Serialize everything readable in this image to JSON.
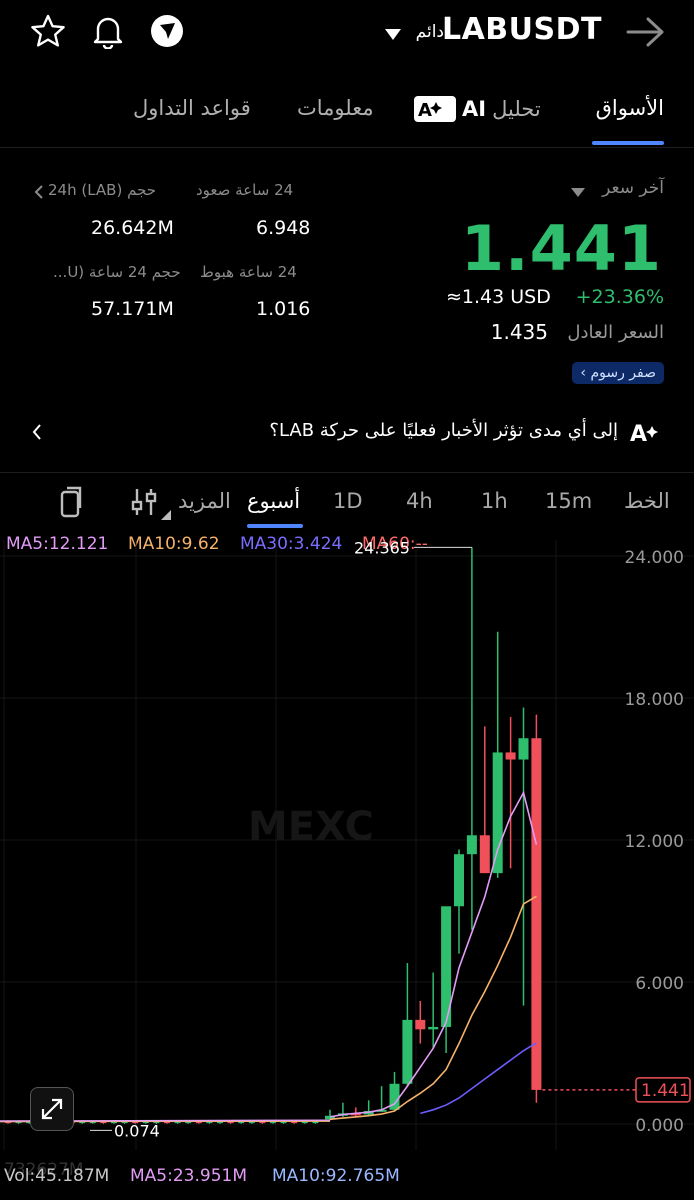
{
  "header": {
    "symbol": "LABUSDT",
    "contract_type": "دائم",
    "icons": [
      "star-icon",
      "bell-icon",
      "share-icon",
      "back-arrow-icon",
      "caret-down-icon"
    ]
  },
  "tabs": [
    {
      "label": "الأسواق",
      "active": true
    },
    {
      "label": "تحليل",
      "ai": "AI",
      "active": false
    },
    {
      "label": "معلومات",
      "active": false
    },
    {
      "label": "قواعد التداول",
      "active": false
    }
  ],
  "price": {
    "last_label": "آخر سعر",
    "last": "1.441",
    "usd": "≈1.43 USD",
    "change": "+23.36%",
    "fair_label": "السعر العادل",
    "fair": "1.435",
    "fee_badge": "صفر رسوم"
  },
  "stats": {
    "high_label": "24 ساعة صعود",
    "high": "6.948",
    "low_label": "24 ساعة هبوط",
    "low": "1.016",
    "vol_lab_label": "حجم 24h (LAB)",
    "vol_lab": "26.642M",
    "vol_u_label": "حجم 24 ساعة (U...",
    "vol_u": "57.171M"
  },
  "news": {
    "text": "إلى أي مدى تؤثر الأخبار فعليًا على حركة LAB؟"
  },
  "intervals": {
    "line": "الخط",
    "m15": "15m",
    "h1": "1h",
    "h4": "4h",
    "d1": "1D",
    "week": "أسبوع",
    "more": "المزيد"
  },
  "chart_data": {
    "type": "candlestick",
    "interval": "أسبوع",
    "ma_labels": {
      "ma5": "MA5:12.121",
      "ma10": "MA10:9.62",
      "ma30": "MA30:3.424",
      "ma60": "MA60:--"
    },
    "y_ticks": [
      "24.000",
      "18.000",
      "12.000",
      "6.000",
      "0.000"
    ],
    "y_tick_values": [
      24,
      18,
      12,
      6,
      0
    ],
    "ylim": [
      -0.3,
      24.9
    ],
    "high_marker": "24.365",
    "low_marker": "0.074",
    "current_price": "1.441",
    "current": 1.441,
    "watermark": "MEXC",
    "colors": {
      "up": "#2fbd6e",
      "down": "#f0505a",
      "ma5": "#e39cf6",
      "ma10": "#f6b36a",
      "ma30": "#6d5cff",
      "ma60": "#ff6b6b"
    },
    "flat_count": 30,
    "flat_value": 0.08,
    "candles": [
      {
        "o": 0.2,
        "h": 0.6,
        "l": 0.15,
        "c": 0.35
      },
      {
        "o": 0.35,
        "h": 0.9,
        "l": 0.3,
        "c": 0.45
      },
      {
        "o": 0.45,
        "h": 0.7,
        "l": 0.3,
        "c": 0.4
      },
      {
        "o": 0.4,
        "h": 1.0,
        "l": 0.35,
        "c": 0.55
      },
      {
        "o": 0.55,
        "h": 1.6,
        "l": 0.5,
        "c": 0.6
      },
      {
        "o": 0.6,
        "h": 2.2,
        "l": 0.55,
        "c": 1.7
      },
      {
        "o": 1.7,
        "h": 6.8,
        "l": 1.6,
        "c": 4.4
      },
      {
        "o": 4.4,
        "h": 5.2,
        "l": 3.4,
        "c": 4.0
      },
      {
        "o": 4.0,
        "h": 6.4,
        "l": 3.2,
        "c": 4.1
      },
      {
        "o": 4.1,
        "h": 9.0,
        "l": 3.0,
        "c": 9.2
      },
      {
        "o": 9.2,
        "h": 11.6,
        "l": 7.2,
        "c": 11.4
      },
      {
        "o": 11.4,
        "h": 24.365,
        "l": 8.2,
        "c": 12.2
      },
      {
        "o": 12.2,
        "h": 16.8,
        "l": 10.6,
        "c": 10.6
      },
      {
        "o": 10.6,
        "h": 20.8,
        "l": 10.4,
        "c": 15.7
      },
      {
        "o": 15.7,
        "h": 17.2,
        "l": 10.8,
        "c": 15.4
      },
      {
        "o": 15.4,
        "h": 17.6,
        "l": 5.0,
        "c": 16.3
      },
      {
        "o": 16.3,
        "h": 17.3,
        "l": 0.9,
        "c": 1.441
      }
    ],
    "ma5_line": [
      0.3,
      0.4,
      0.45,
      0.5,
      0.6,
      0.85,
      1.6,
      2.4,
      3.2,
      4.3,
      6.6,
      8.1,
      9.6,
      11.6,
      13.0,
      14.0,
      11.8
    ],
    "ma10_line": [
      0.2,
      0.25,
      0.3,
      0.35,
      0.42,
      0.55,
      0.95,
      1.3,
      1.7,
      2.3,
      3.4,
      4.6,
      5.6,
      6.7,
      7.9,
      9.3,
      9.62
    ],
    "ma30_line": [
      null,
      null,
      null,
      null,
      null,
      null,
      null,
      0.45,
      0.6,
      0.8,
      1.1,
      1.5,
      1.9,
      2.3,
      2.7,
      3.1,
      3.424
    ],
    "volume": {
      "vol_label": "Vol:45.187M",
      "ma5_label": "MA5:23.951M",
      "ma10_label": "MA10:92.765M",
      "ghost": "732627M"
    }
  }
}
